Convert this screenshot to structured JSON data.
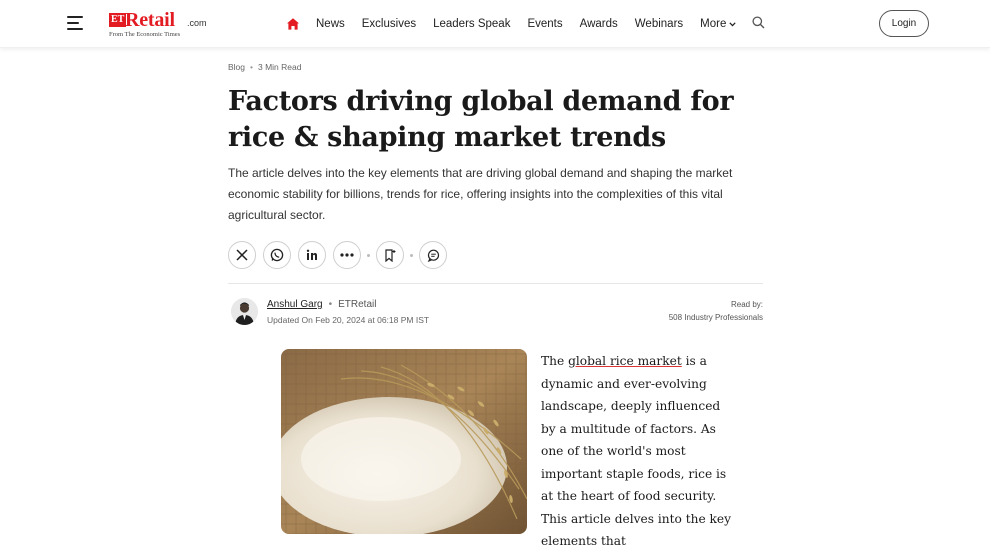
{
  "header": {
    "logo": {
      "et": "ET",
      "name": "Retail",
      "dotcom": ".com",
      "tagline": "From The Economic Times"
    },
    "nav": [
      {
        "label": "News"
      },
      {
        "label": "Exclusives"
      },
      {
        "label": "Leaders Speak"
      },
      {
        "label": "Events"
      },
      {
        "label": "Awards"
      },
      {
        "label": "Webinars"
      }
    ],
    "more_label": "More",
    "login_label": "Login",
    "accent_color": "#e31b23"
  },
  "article": {
    "category": "Blog",
    "read_time": "3 Min Read",
    "title": "Factors driving global demand for rice & shaping market trends",
    "summary": "The article delves into the key elements that are driving global demand and shaping the market economic stability for billions, trends for rice, offering insights into the complexities of this vital agricultural sector.",
    "share_icons": [
      "x-icon",
      "whatsapp-icon",
      "linkedin-icon",
      "more-dots-icon",
      "bookmark-icon",
      "comment-icon"
    ],
    "author": {
      "name": "Anshul Garg",
      "source": "ETRetail",
      "updated": "Updated On Feb 20, 2024 at 06:18 PM IST"
    },
    "read_by": {
      "label": "Read by:",
      "value": "508 Industry Professionals"
    },
    "body": {
      "prefix": "The ",
      "link_text": "global rice market",
      "rest": " is a dynamic and ever-evolving landscape, deeply influenced by a multitude of factors. As one of the world's most important staple foods, rice is at the heart of food security. This article delves into the key elements that"
    }
  }
}
